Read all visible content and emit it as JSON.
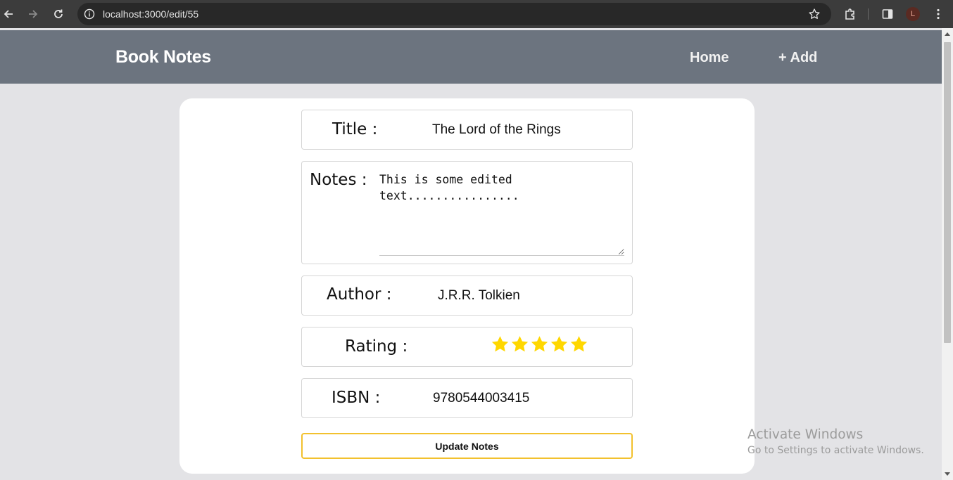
{
  "browser": {
    "url": "localhost:3000/edit/55",
    "profile_initial": "L"
  },
  "header": {
    "brand": "Book Notes",
    "nav": [
      {
        "label": "Home"
      },
      {
        "label": "+ Add"
      }
    ]
  },
  "form": {
    "title_label": "Title :",
    "title_value": "The Lord of the Rings",
    "notes_label": "Notes :",
    "notes_value": "This is some edited text................",
    "author_label": "Author :",
    "author_value": "J.R.R. Tolkien",
    "rating_label": "Rating :",
    "rating_value": 5,
    "rating_max": 5,
    "isbn_label": "ISBN :",
    "isbn_value": "9780544003415",
    "submit_label": "Update Notes"
  },
  "watermark": {
    "title": "Activate Windows",
    "subtitle": "Go to Settings to activate Windows."
  },
  "colors": {
    "header_bg": "#6c747f",
    "star": "#ffd700",
    "button_border": "#f2c12e"
  }
}
